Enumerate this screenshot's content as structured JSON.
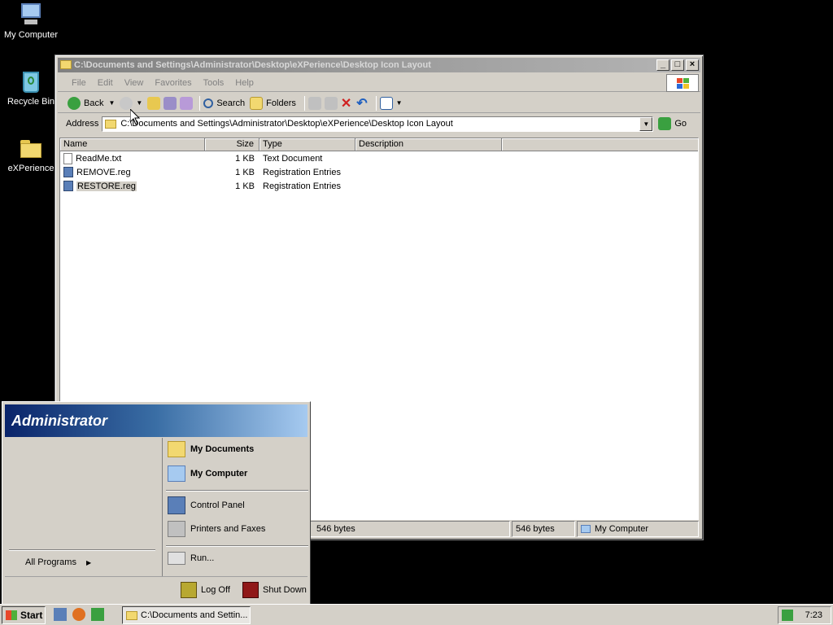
{
  "desktop": {
    "icons": [
      {
        "label": "My Computer",
        "icon": "my-computer-icon"
      },
      {
        "label": "Recycle Bin",
        "icon": "recycle-bin-icon"
      },
      {
        "label": "eXPerience",
        "icon": "folder-icon"
      }
    ]
  },
  "window": {
    "title": "C:\\Documents and Settings\\Administrator\\Desktop\\eXPerience\\Desktop Icon Layout",
    "menu": [
      "File",
      "Edit",
      "View",
      "Favorites",
      "Tools",
      "Help"
    ],
    "toolbar": {
      "back": "Back",
      "search": "Search",
      "folders": "Folders"
    },
    "address": {
      "label": "Address",
      "value": "C:\\Documents and Settings\\Administrator\\Desktop\\eXPerience\\Desktop Icon Layout",
      "go": "Go"
    },
    "columns": [
      "Name",
      "Size",
      "Type",
      "Description"
    ],
    "files": [
      {
        "name": "ReadMe.txt",
        "size": "1 KB",
        "type": "Text Document"
      },
      {
        "name": "REMOVE.reg",
        "size": "1 KB",
        "type": "Registration Entries"
      },
      {
        "name": "RESTORE.reg",
        "size": "1 KB",
        "type": "Registration Entries"
      }
    ],
    "status": {
      "left": "546 bytes",
      "mid": "546 bytes",
      "right": "My Computer"
    }
  },
  "startmenu": {
    "user": "Administrator",
    "right_items": [
      "My Documents",
      "My Computer",
      "Control Panel",
      "Printers and Faxes",
      "Run..."
    ],
    "all_programs": "All Programs",
    "log_off": "Log Off",
    "shut_down": "Shut Down"
  },
  "taskbar": {
    "start": "Start",
    "task": "C:\\Documents and Settin...",
    "clock": "7:23"
  },
  "colors": {
    "selection": "#d4d0c8",
    "titlebar_inactive": "#808080",
    "start_header": "#0a246a"
  }
}
